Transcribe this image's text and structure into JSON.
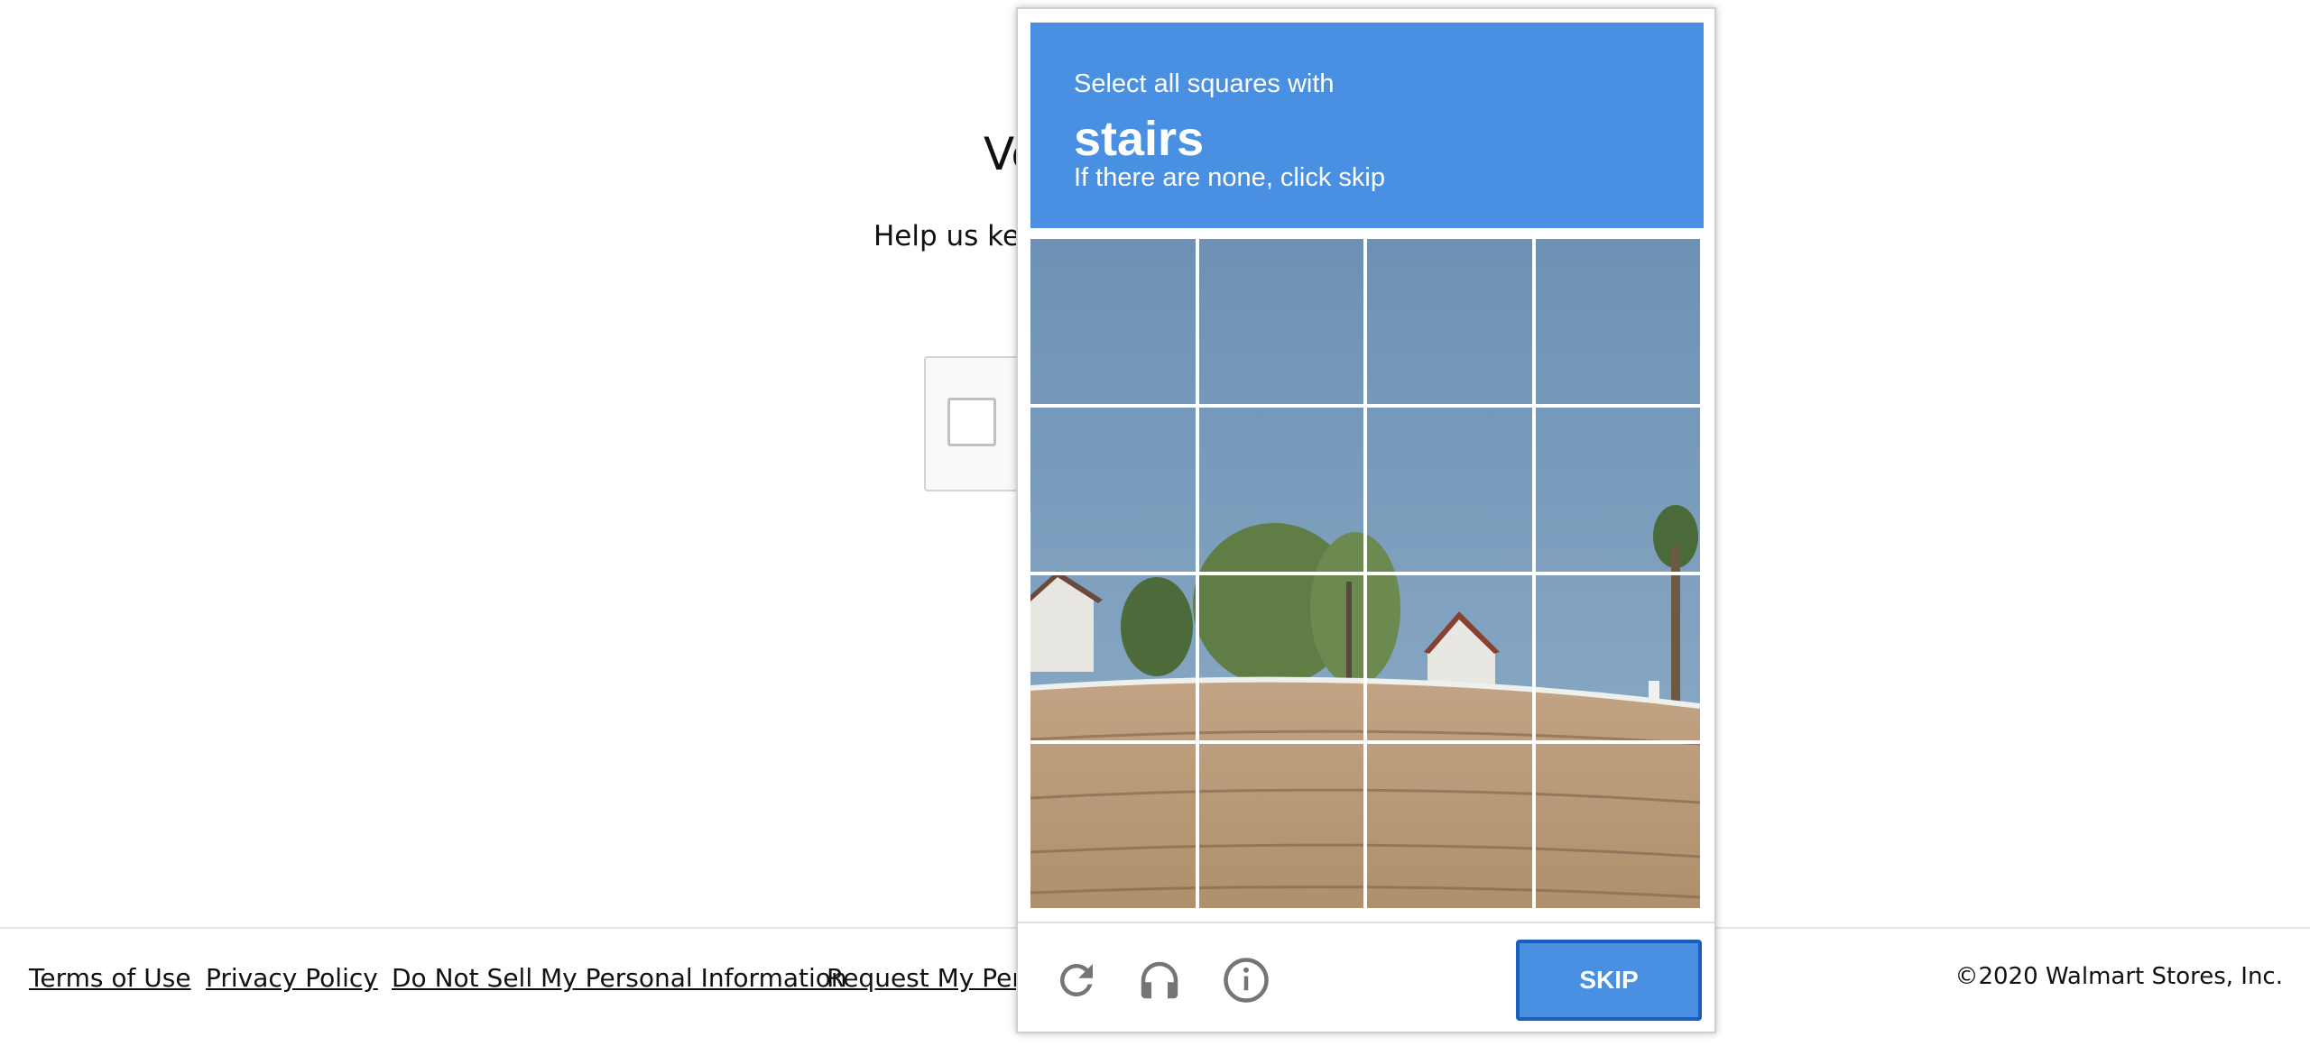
{
  "page": {
    "title_visible": "Ve",
    "subtitle_visible": "Help us kee",
    "footer_links": [
      {
        "label": "Terms of Use"
      },
      {
        "label": "Privacy Policy"
      },
      {
        "label": "Do Not Sell My Personal Information"
      },
      {
        "label": "Request My Perso"
      }
    ],
    "copyright": "©2020 Walmart Stores, Inc."
  },
  "challenge": {
    "prompt": "Select all squares with",
    "keyword": "stairs",
    "hint": "If there are none, click skip",
    "grid": {
      "rows": 4,
      "cols": 4
    },
    "skip_label": "SKIP",
    "icons": [
      "reload-icon",
      "audio-icon",
      "info-icon"
    ],
    "colors": {
      "header": "#4a90e2",
      "skip_border": "#1a5fc0",
      "sky": "#8fb0c9",
      "ground": "#b08f6c"
    }
  }
}
